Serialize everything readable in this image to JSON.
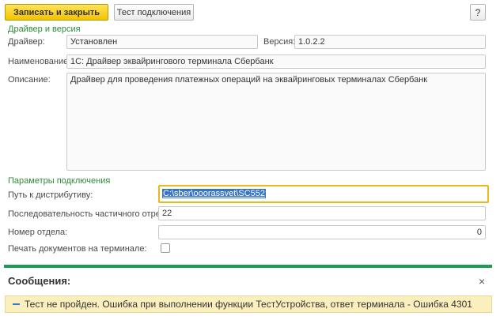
{
  "toolbar": {
    "save_close": "Записать и закрыть",
    "test_connection": "Тест подключения",
    "help": "?"
  },
  "driver_section": {
    "title": "Драйвер и версия",
    "driver_label": "Драйвер:",
    "driver_value": "Установлен",
    "version_label": "Версия:",
    "version_value": "1.0.2.2",
    "name_label": "Наименование:",
    "name_value": "1С: Драйвер эквайрингового терминала Сбербанк",
    "description_label": "Описание:",
    "description_value": "Драйвер для проведения платежных операций на эквайринговых терминалах Сбербанк"
  },
  "connection_section": {
    "title": "Параметры подключения",
    "path_label": "Путь к дистрибутиву:",
    "path_value": "C:\\sber\\ooorassvet\\SC552",
    "partial_cut_label": "Последовательность частичного отреза:",
    "partial_cut_value": "22",
    "department_label": "Номер отдела:",
    "department_value": "0",
    "print_label": "Печать документов на терминале:",
    "print_checked": false
  },
  "messages": {
    "title": "Сообщения:",
    "close": "×",
    "text": "Тест не пройден. Ошибка при выполнении функции ТестУстройства, ответ терминала - Ошибка 4301"
  },
  "colors": {
    "primary_button": "#f3c300",
    "section_title": "#2e8b3a",
    "divider": "#1b9b55",
    "message_bg": "#fbefbd",
    "selection": "#3874c8"
  }
}
